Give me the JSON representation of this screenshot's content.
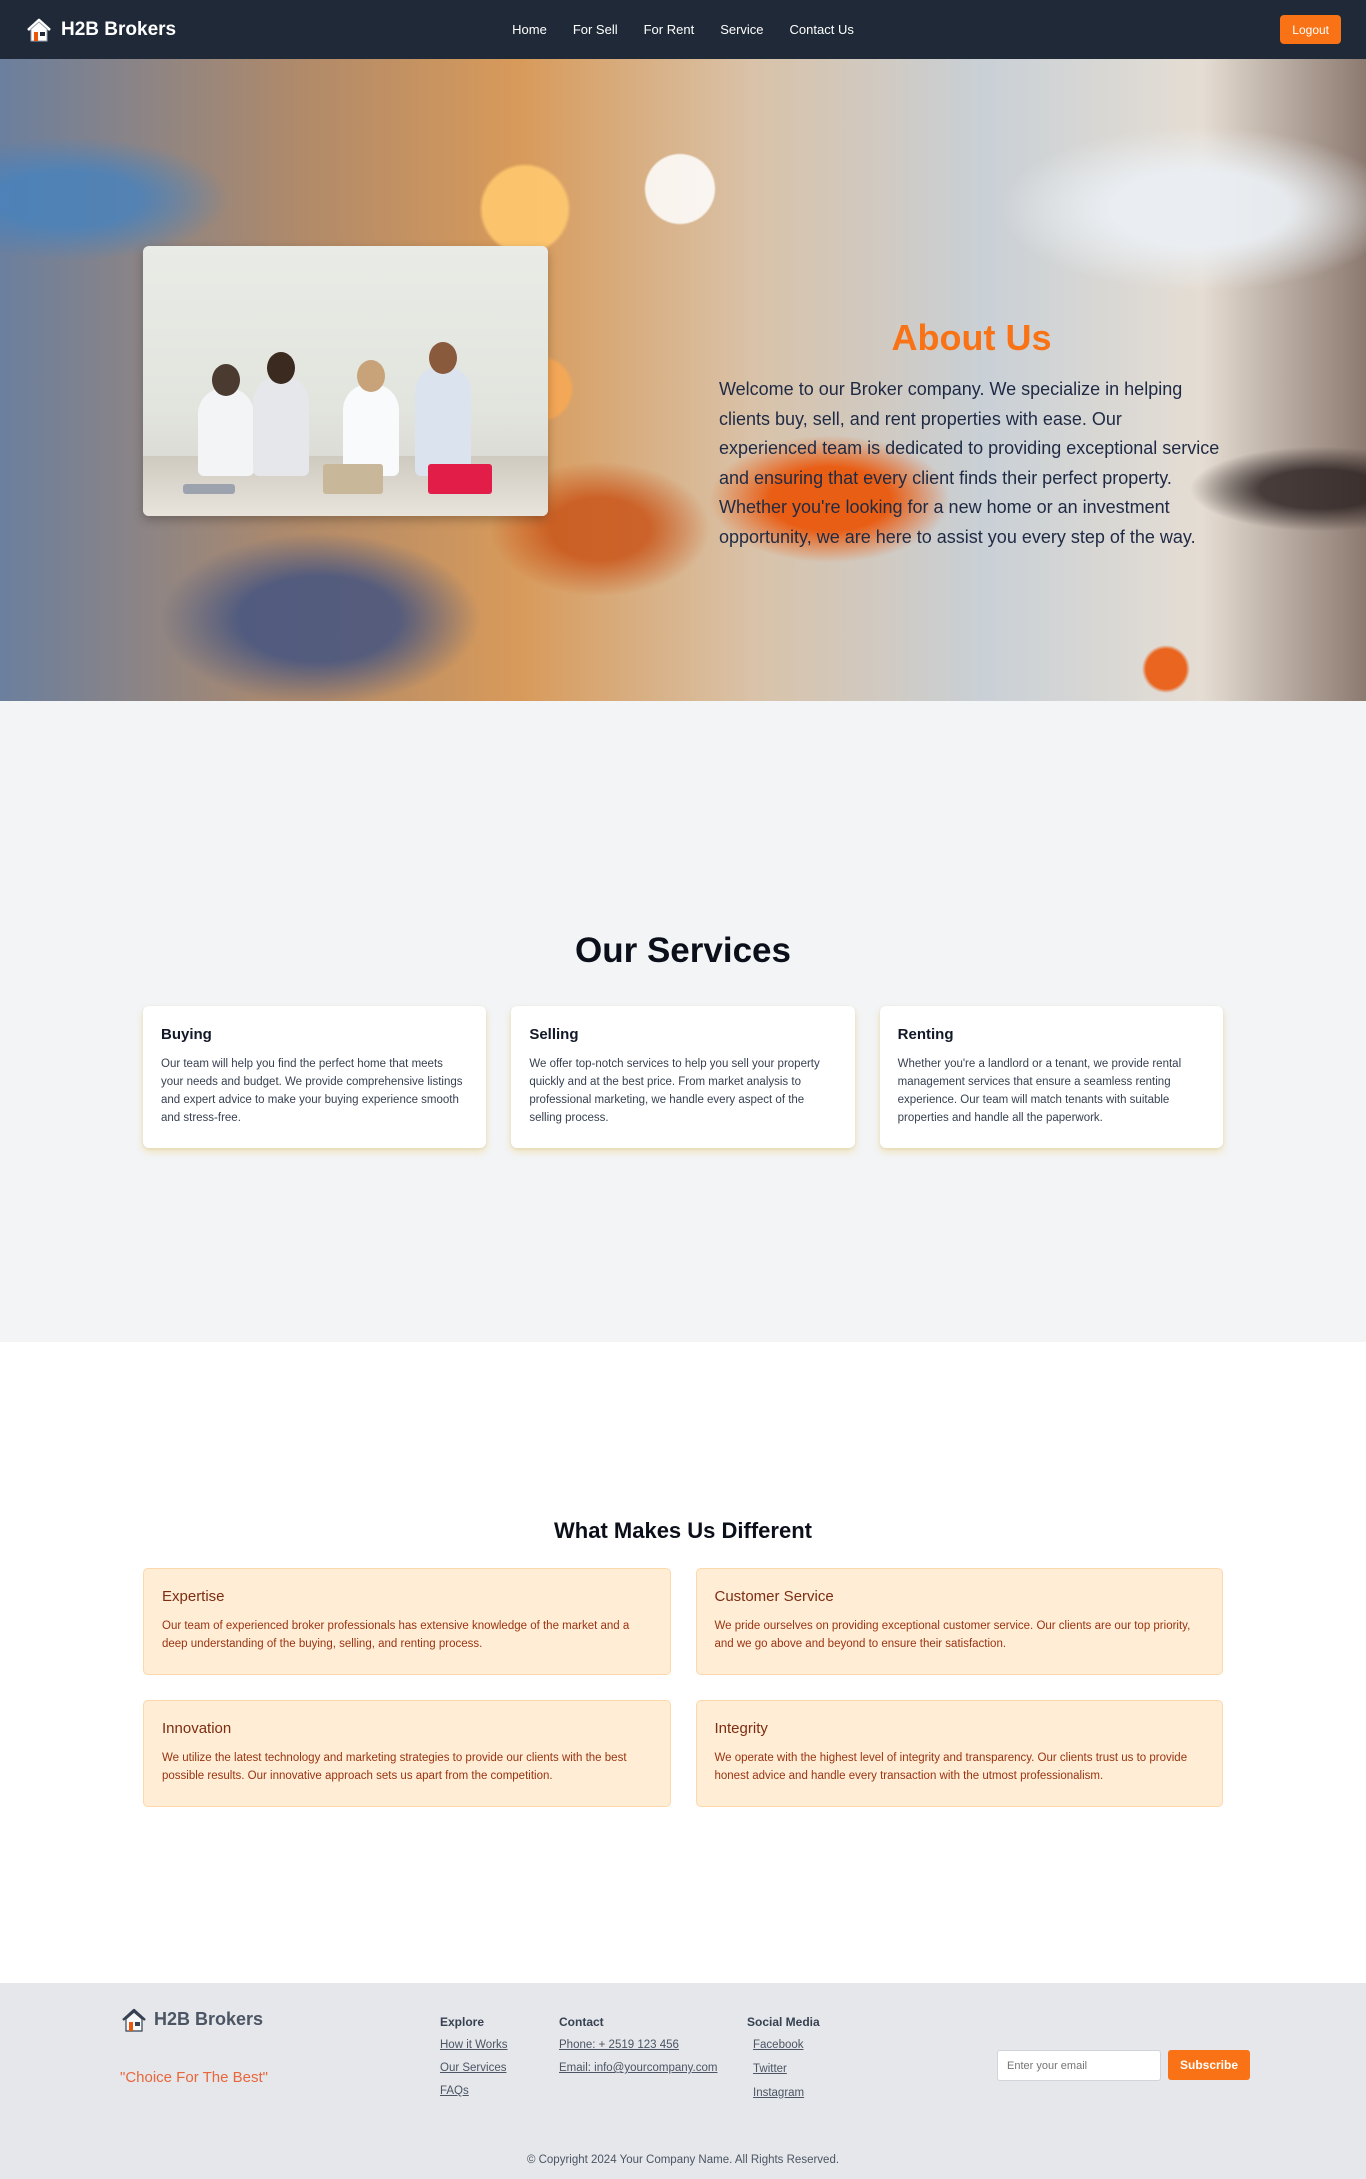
{
  "nav": {
    "brand": "H2B Brokers",
    "links": [
      "Home",
      "For Sell",
      "For Rent",
      "Service",
      "Contact Us"
    ],
    "logout": "Logout"
  },
  "about": {
    "title": "About Us",
    "text": "Welcome to our Broker company. We specialize in helping clients buy, sell, and rent properties with ease. Our experienced team is dedicated to providing exceptional service and ensuring that every client finds their perfect property. Whether you're looking for a new home or an investment opportunity, we are here to assist you every step of the way."
  },
  "services": {
    "title": "Our Services",
    "cards": [
      {
        "title": "Buying",
        "text": "Our team will help you find the perfect home that meets your needs and budget. We provide comprehensive listings and expert advice to make your buying experience smooth and stress-free."
      },
      {
        "title": "Selling",
        "text": "We offer top-notch services to help you sell your property quickly and at the best price. From market analysis to professional marketing, we handle every aspect of the selling process."
      },
      {
        "title": "Renting",
        "text": "Whether you're a landlord or a tenant, we provide rental management services that ensure a seamless renting experience. Our team will match tenants with suitable properties and handle all the paperwork."
      }
    ]
  },
  "different": {
    "title": "What Makes Us Different",
    "cards": [
      {
        "title": "Expertise",
        "text": "Our team of experienced broker professionals has extensive knowledge of the market and a deep understanding of the buying, selling, and renting process."
      },
      {
        "title": "Customer Service",
        "text": "We pride ourselves on providing exceptional customer service. Our clients are our top priority, and we go above and beyond to ensure their satisfaction."
      },
      {
        "title": "Innovation",
        "text": "We utilize the latest technology and marketing strategies to provide our clients with the best possible results. Our innovative approach sets us apart from the competition."
      },
      {
        "title": "Integrity",
        "text": "We operate with the highest level of integrity and transparency. Our clients trust us to provide honest advice and handle every transaction with the utmost professionalism."
      }
    ]
  },
  "footer": {
    "brand": "H2B Brokers",
    "tagline": "\"Choice For The Best\"",
    "explore": {
      "heading": "Explore",
      "links": [
        "How it Works",
        "Our Services",
        "FAQs"
      ]
    },
    "contact": {
      "heading": "Contact",
      "links": [
        "Phone: + 2519 123 456",
        "Email: info@yourcompany.com"
      ]
    },
    "social": {
      "heading": "Social Media",
      "links": [
        "Facebook",
        "Twitter",
        "Instagram"
      ]
    },
    "subscribe": {
      "placeholder": "Enter your email",
      "button": "Subscribe"
    },
    "copyright": "© Copyright 2024 Your Company Name. All Rights Reserved."
  },
  "colors": {
    "accent": "#f97316",
    "navbar": "#1f2937",
    "card_tint": "#ffedd5"
  },
  "icons": {
    "brand": "house-icon"
  }
}
